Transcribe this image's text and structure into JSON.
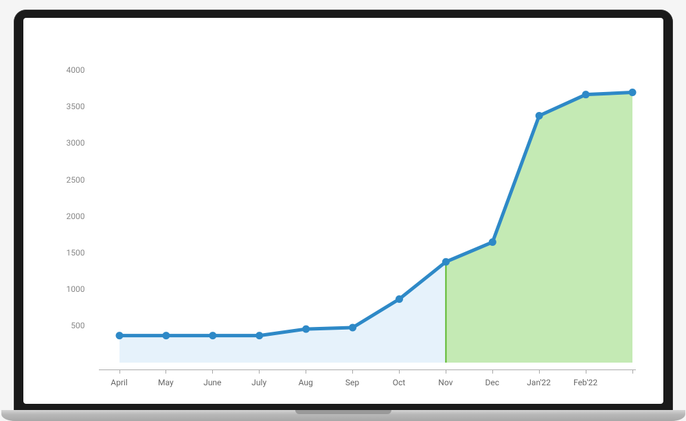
{
  "chart_data": {
    "type": "area",
    "categories": [
      "April",
      "May",
      "June",
      "July",
      "Aug",
      "Sep",
      "Oct",
      "Nov",
      "Dec",
      "Jan'22",
      "Feb'22"
    ],
    "values": [
      370,
      370,
      370,
      370,
      460,
      480,
      870,
      1380,
      1650,
      3380,
      3670,
      3700
    ],
    "xlabel": "",
    "ylabel": "",
    "ylim": [
      0,
      4250
    ],
    "y_ticks": [
      500,
      1000,
      1500,
      2000,
      2500,
      3000,
      3500,
      4000
    ],
    "highlight_start_index": 7,
    "colors": {
      "line": "#2e89c7",
      "fill_light": "#e6f2fb",
      "fill_highlight": "#b0e39b",
      "highlight_border": "#5cb82c",
      "marker_fill": "#2e89c7",
      "axis": "#aaaaaa",
      "tick_text": "#888888"
    }
  }
}
